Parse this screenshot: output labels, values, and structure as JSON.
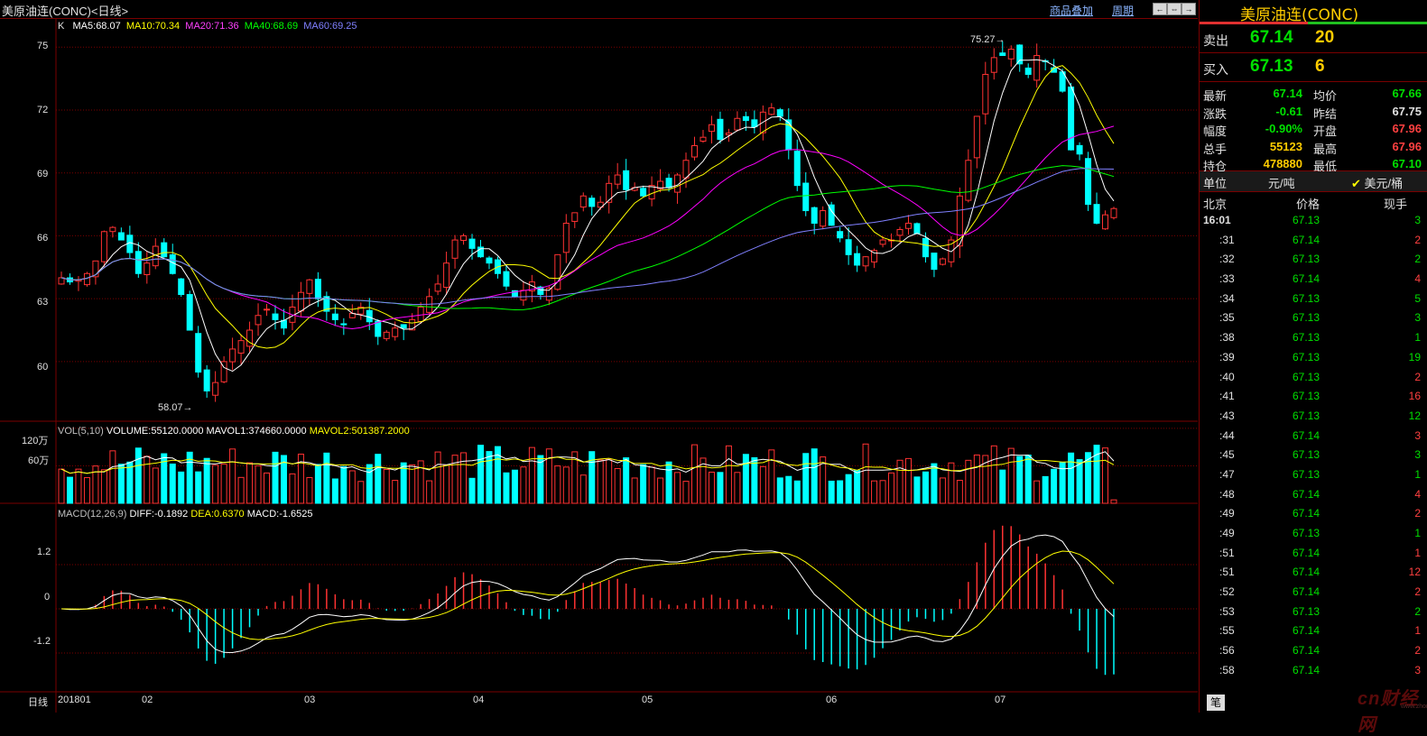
{
  "window": {
    "title": "美原油连(CONC)<日线>",
    "links": [
      "商品叠加",
      "周期"
    ],
    "buttons": [
      "←",
      "⇔",
      "→"
    ]
  },
  "colors": {
    "up": "#ff3232",
    "down": "#00ffff",
    "ma5": "#ffffff",
    "ma10": "#ffff00",
    "ma20": "#ff00ff",
    "ma40": "#00ff00",
    "ma60": "#8080ff",
    "grid": "#7a0000"
  },
  "price_panel": {
    "ma_labels": [
      "K",
      "MA5:68.07",
      "MA10:70.34",
      "MA20:71.36",
      "MA40:68.69",
      "MA60:69.25"
    ],
    "y_ticks": [
      "75",
      "72",
      "69",
      "66",
      "63",
      "60"
    ],
    "high_annotation": "75.27→",
    "low_annotation": "58.07→"
  },
  "volume_panel": {
    "labels": [
      "VOL(5,10)",
      "VOLUME:55120.0000",
      "MAVOL1:374660.0000",
      "MAVOL2:501387.2000"
    ],
    "y_ticks": [
      "120万",
      "60万"
    ]
  },
  "macd_panel": {
    "labels": [
      "MACD(12,26,9)",
      "DIFF:-0.1892",
      "DEA:0.6370",
      "MACD:-1.6525"
    ],
    "y_ticks": [
      "1.2",
      "0",
      "-1.2"
    ]
  },
  "x_axis": {
    "period_label": "日线",
    "ticks": [
      "201801",
      "02",
      "03",
      "04",
      "05",
      "06",
      "07"
    ]
  },
  "chart_data": {
    "type": "candlestick",
    "ylim": [
      57.5,
      76.0
    ],
    "close_path": [
      64.0,
      63.8,
      63.9,
      64.2,
      64.8,
      66.2,
      66.4,
      65.8,
      65.2,
      64.2,
      64.7,
      65.5,
      65.0,
      64.2,
      63.2,
      61.5,
      59.5,
      58.6,
      59.0,
      60.0,
      60.6,
      61.0,
      61.5,
      62.2,
      62.5,
      62.0,
      61.6,
      62.6,
      63.3,
      63.9,
      63.0,
      62.4,
      62.0,
      61.8,
      62.3,
      62.6,
      61.9,
      61.2,
      61.4,
      61.6,
      61.6,
      62.0,
      62.6,
      63.1,
      63.7,
      64.7,
      65.8,
      66.0,
      65.4,
      65.0,
      64.7,
      64.2,
      63.6,
      63.1,
      63.4,
      63.8,
      63.2,
      63.5,
      65.1,
      66.6,
      67.1,
      67.9,
      67.4,
      67.6,
      68.5,
      68.9,
      68.2,
      68.3,
      67.9,
      68.4,
      68.6,
      68.3,
      68.9,
      69.6,
      70.3,
      70.7,
      71.3,
      70.6,
      70.9,
      71.6,
      71.5,
      71.2,
      71.9,
      72.1,
      71.7,
      70.1,
      68.4,
      67.2,
      66.6,
      67.2,
      66.5,
      65.9,
      65.1,
      64.6,
      65.0,
      65.3,
      65.8,
      65.8,
      66.3,
      66.6,
      66.1,
      65.0,
      64.4,
      64.9,
      65.8,
      67.9,
      69.6,
      71.7,
      73.7,
      74.5,
      74.6,
      74.9,
      74.2,
      73.7,
      74.6,
      74.3,
      73.8,
      72.9,
      70.1,
      69.9,
      67.5,
      66.6,
      67.0,
      67.3
    ]
  }
}
